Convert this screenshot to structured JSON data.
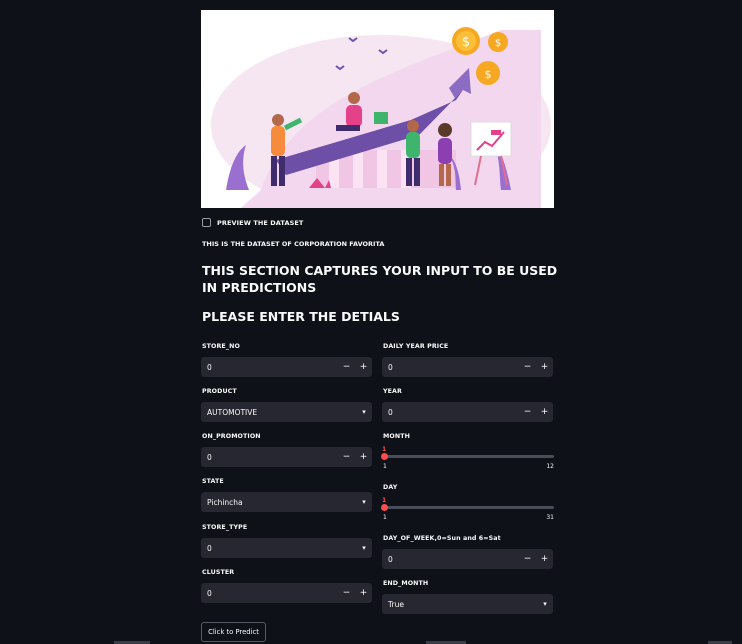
{
  "preview_checkbox": {
    "label": "PREVIEW THE DATASET",
    "checked": false
  },
  "caption": "THIS IS THE DATASET OF CORPORATION FAVORITA",
  "section_heading": "THIS SECTION CAPTURES YOUR INPUT TO BE USED IN PREDICTIONS",
  "details_heading": "PLEASE ENTER THE DETIALS",
  "left_fields": {
    "store_no": {
      "label": "STORE_NO",
      "value": "0"
    },
    "product": {
      "label": "PRODUCT",
      "value": "AUTOMOTIVE"
    },
    "on_promotion": {
      "label": "ON_PROMOTION",
      "value": "0"
    },
    "state": {
      "label": "STATE",
      "value": "Pichincha"
    },
    "store_type": {
      "label": "STORE_TYPE",
      "value": "0"
    },
    "cluster": {
      "label": "CLUSTER",
      "value": "0"
    }
  },
  "right_fields": {
    "daily_year_price": {
      "label": "DAILY YEAR PRICE",
      "value": "0"
    },
    "year": {
      "label": "YEAR",
      "value": "0"
    },
    "month": {
      "label": "MONTH",
      "value": "1",
      "min": "1",
      "max": "12"
    },
    "day": {
      "label": "DAY",
      "value": "1",
      "min": "1",
      "max": "31"
    },
    "day_of_week": {
      "label": "DAY_OF_WEEK,0=Sun and 6=Sat",
      "value": "0"
    },
    "end_month": {
      "label": "END_MONTH",
      "value": "True"
    }
  },
  "stepper": {
    "minus": "−",
    "plus": "+"
  },
  "dropdown_chevron": "▾",
  "predict_button": "Click to Predict",
  "hero_image": {
    "icons": [
      "rising-arrow-illustration",
      "gold-coin-icon",
      "people-illustration",
      "chart-easel-icon"
    ],
    "coin_symbol": "$"
  },
  "colors": {
    "background": "#0e1117",
    "field_bg": "#262730",
    "accent": "#ff4b4b",
    "text": "#fafafa"
  }
}
